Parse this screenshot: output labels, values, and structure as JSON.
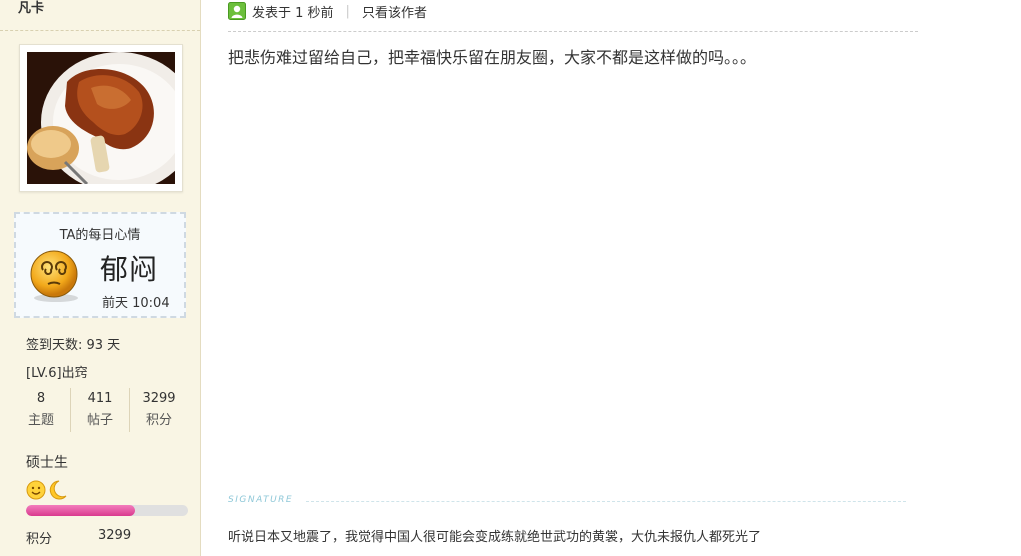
{
  "user": {
    "name": "凡卡"
  },
  "mood": {
    "title": "TA的每日心情",
    "name": "郁闷",
    "time": "前天 10:04",
    "icon": "depressed-face-icon"
  },
  "stats": {
    "checkin": "签到天数: 93 天",
    "level": "[LV.6]出窍",
    "counts": [
      {
        "num": "8",
        "label": "主题"
      },
      {
        "num": "411",
        "label": "帖子"
      },
      {
        "num": "3299",
        "label": "积分"
      }
    ]
  },
  "rank": {
    "title": "硕士生",
    "progress": 0.67,
    "score_label": "积分",
    "score_value": "3299",
    "bar_color": "#e0529f"
  },
  "post": {
    "meta": {
      "posted": "发表于 1 秒前",
      "author_only": "只看该作者"
    },
    "body": "把悲伤难过留给自己，把幸福快乐留在朋友圈，大家不都是这样做的吗。。。"
  },
  "signature": {
    "label": "SIGNATURE",
    "text": "听说日本又地震了，我觉得中国人很可能会变成练就绝世武功的黄裳，大仇未报仇人都死光了"
  }
}
